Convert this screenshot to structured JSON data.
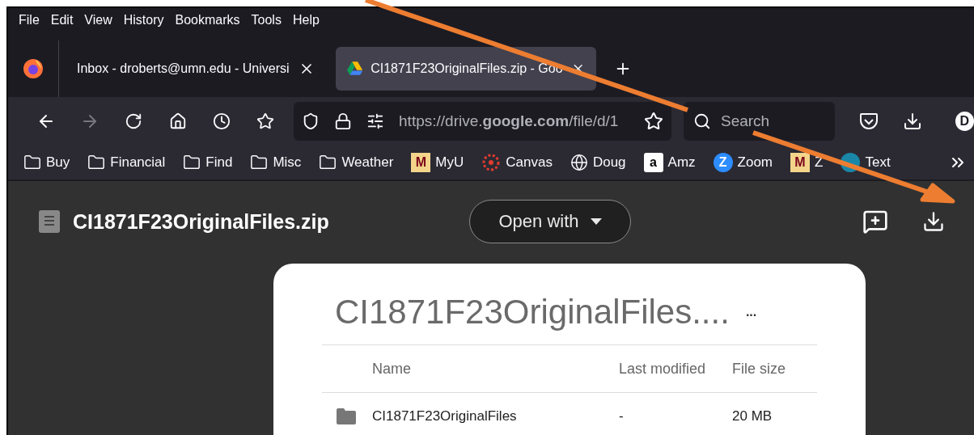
{
  "menu": [
    "File",
    "Edit",
    "View",
    "History",
    "Bookmarks",
    "Tools",
    "Help"
  ],
  "tabs": [
    {
      "title": "Inbox - droberts@umn.edu - Universi",
      "kind": "mail",
      "selected": false
    },
    {
      "title": "CI1871F23OriginalFiles.zip - Goo",
      "kind": "drive",
      "selected": true
    }
  ],
  "address_bar": {
    "url": "https://drive.**google.com**/file/d/1"
  },
  "search": {
    "placeholder": "Search"
  },
  "account": {
    "initial": "D"
  },
  "bookmarks": [
    {
      "label": "Buy",
      "kind": "folder"
    },
    {
      "label": "Financial",
      "kind": "folder"
    },
    {
      "label": "Find",
      "kind": "folder"
    },
    {
      "label": "Misc",
      "kind": "folder"
    },
    {
      "label": "Weather",
      "kind": "folder"
    },
    {
      "label": "MyU",
      "kind": "umn",
      "icon_text": "M"
    },
    {
      "label": "Canvas",
      "kind": "canvas"
    },
    {
      "label": "Doug",
      "kind": "globe"
    },
    {
      "label": "Amz",
      "kind": "amazon",
      "icon_text": "a"
    },
    {
      "label": "Zoom",
      "kind": "zoom",
      "icon_text": "Z"
    },
    {
      "label": "Z",
      "kind": "umn",
      "icon_text": "M"
    },
    {
      "label": "Text",
      "kind": "pearson"
    }
  ],
  "viewer": {
    "file_name": "CI1871F23OriginalFiles.zip",
    "open_with": "Open with"
  },
  "archive": {
    "title": "CI1871F23OriginalFiles....",
    "more": "...",
    "columns": [
      "Name",
      "Last modified",
      "File size"
    ],
    "rows": [
      {
        "kind": "folder",
        "name": "CI1871F23OriginalFiles",
        "modified": "-",
        "size": "20 MB"
      }
    ]
  }
}
